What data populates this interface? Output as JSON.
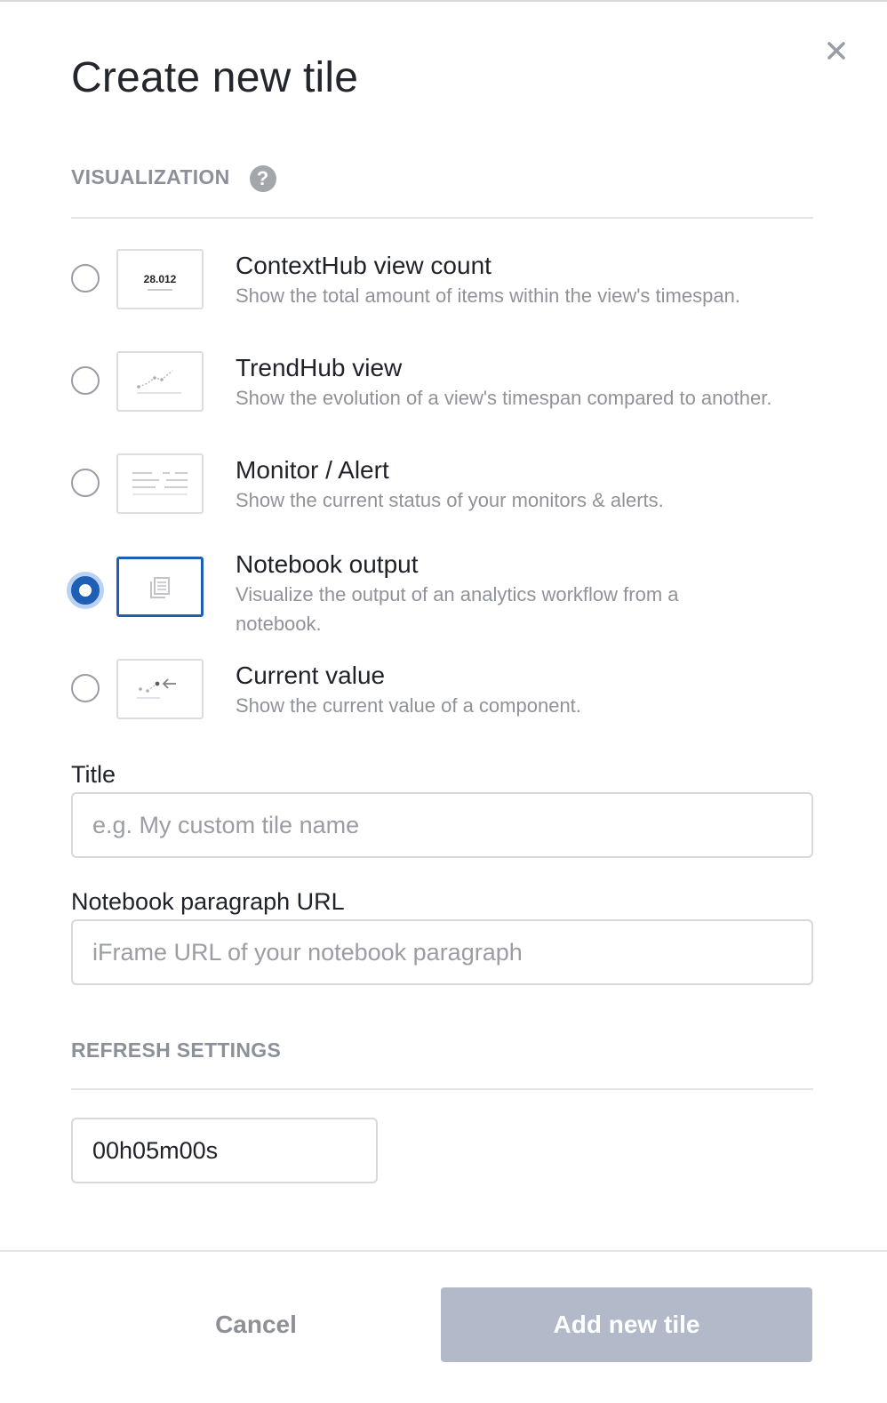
{
  "dialog": {
    "title": "Create new tile",
    "close_label": "×"
  },
  "visualization": {
    "section_label": "VISUALIZATION",
    "help_label": "?",
    "selected": "notebook-output",
    "options": [
      {
        "id": "contexthub-view-count",
        "title": "ContextHub view count",
        "description": "Show the total amount of items within the view's timespan.",
        "thumb_text": "28.012",
        "icon": "number-icon",
        "checked": false
      },
      {
        "id": "trendhub-view",
        "title": "TrendHub view",
        "description": "Show the evolution of a view's timespan compared to another.",
        "icon": "trend-line-icon",
        "checked": false
      },
      {
        "id": "monitor-alert",
        "title": "Monitor / Alert",
        "description": "Show the current status of your monitors & alerts.",
        "icon": "list-lines-icon",
        "checked": false
      },
      {
        "id": "notebook-output",
        "title": "Notebook output",
        "description": "Visualize the output of an analytics workflow from a notebook.",
        "icon": "notebook-icon",
        "checked": true
      },
      {
        "id": "current-value",
        "title": "Current value",
        "description": "Show the current value of a component.",
        "icon": "current-value-icon",
        "checked": false
      }
    ]
  },
  "form": {
    "title_label": "Title",
    "title_placeholder": "e.g. My custom tile name",
    "title_value": "",
    "url_label": "Notebook paragraph URL",
    "url_placeholder": "iFrame URL of your notebook paragraph",
    "url_value": ""
  },
  "refresh": {
    "section_label": "REFRESH SETTINGS",
    "interval_value": "00h05m00s"
  },
  "footer": {
    "cancel_label": "Cancel",
    "submit_label": "Add new tile"
  },
  "colors": {
    "accent": "#1c5fb4",
    "primary_disabled": "#b2b9c9",
    "muted_text": "#8f9399"
  }
}
